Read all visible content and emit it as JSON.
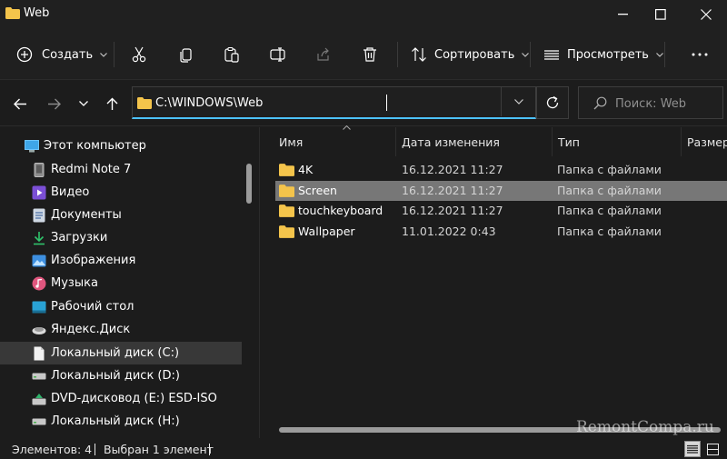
{
  "window": {
    "title": "Web"
  },
  "toolbar": {
    "create_label": "Создать",
    "sort_label": "Сортировать",
    "view_label": "Просмотреть"
  },
  "address": {
    "path": "C:\\WINDOWS\\Web",
    "search_placeholder": "Поиск: Web"
  },
  "sidebar": {
    "items": [
      {
        "label": "Этот компьютер",
        "icon": "monitor-icon"
      },
      {
        "label": "Redmi Note 7",
        "icon": "phone-icon"
      },
      {
        "label": "Видео",
        "icon": "video-icon"
      },
      {
        "label": "Документы",
        "icon": "document-icon"
      },
      {
        "label": "Загрузки",
        "icon": "download-icon"
      },
      {
        "label": "Изображения",
        "icon": "image-icon"
      },
      {
        "label": "Музыка",
        "icon": "music-icon"
      },
      {
        "label": "Рабочий стол",
        "icon": "desktop-icon"
      },
      {
        "label": "Яндекс.Диск",
        "icon": "yandex-disk-icon"
      },
      {
        "label": "Локальный диск (C:)",
        "icon": "drive-icon",
        "selected": true
      },
      {
        "label": "Локальный диск (D:)",
        "icon": "drive-icon"
      },
      {
        "label": "DVD-дисковод (E:) ESD-ISO",
        "icon": "dvd-icon"
      },
      {
        "label": "Локальный диск (H:)",
        "icon": "drive-icon"
      }
    ]
  },
  "columns": {
    "name": "Имя",
    "date": "Дата изменения",
    "type": "Тип",
    "size": "Размер"
  },
  "files": [
    {
      "name": "4K",
      "date": "16.12.2021 11:27",
      "type": "Папка с файлами"
    },
    {
      "name": "Screen",
      "date": "16.12.2021 11:27",
      "type": "Папка с файлами",
      "selected": true
    },
    {
      "name": "touchkeyboard",
      "date": "16.12.2021 11:27",
      "type": "Папка с файлами"
    },
    {
      "name": "Wallpaper",
      "date": "11.01.2022 0:43",
      "type": "Папка с файлами"
    }
  ],
  "status": {
    "items_count": "Элементов: 4",
    "selected_count": "Выбран 1 элемент"
  },
  "watermark": "RemontCompa.ru",
  "colors": {
    "accent": "#4cc2ff",
    "folder": "#f4c44b",
    "selection": "#777777"
  }
}
